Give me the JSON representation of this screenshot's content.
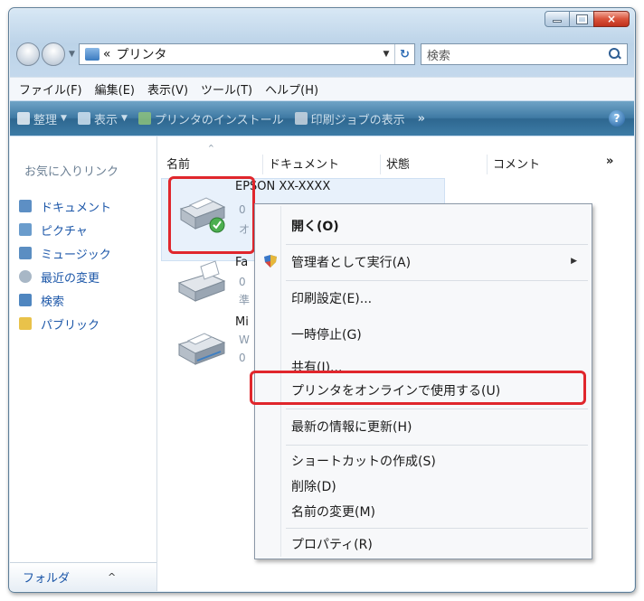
{
  "window": {
    "close_glyph": "×"
  },
  "address": {
    "prefix": "«",
    "path": "プリンタ"
  },
  "search": {
    "placeholder": "検索"
  },
  "menubar": {
    "items": [
      "ファイル(F)",
      "編集(E)",
      "表示(V)",
      "ツール(T)",
      "ヘルプ(H)"
    ]
  },
  "toolbar": {
    "items": [
      {
        "label": "整理",
        "has_dropdown": true
      },
      {
        "label": "表示",
        "has_dropdown": true
      },
      {
        "label": "プリンタのインストール",
        "has_dropdown": false
      },
      {
        "label": "印刷ジョブの表示",
        "has_dropdown": false
      }
    ],
    "more": "»",
    "help": "?"
  },
  "navpane": {
    "title": "お気に入りリンク",
    "items": [
      "ドキュメント",
      "ピクチャ",
      "ミュージック",
      "最近の変更",
      "検索",
      "パブリック"
    ],
    "folders_label": "フォルダ",
    "folders_chevron": "^"
  },
  "columns": {
    "headers": [
      "名前",
      "ドキュメント",
      "状態",
      "コメント"
    ],
    "more": "»"
  },
  "printers": [
    {
      "name": "EPSON XX-XXXX",
      "line1": "0",
      "line2": "オ",
      "selected": true
    },
    {
      "name": "Fa",
      "line1": "0",
      "line2": "準",
      "selected": false
    },
    {
      "name": "Mi",
      "line1": "W",
      "line2": "0",
      "selected": false
    }
  ],
  "context_menu": {
    "items": [
      {
        "label": "開く(O)",
        "bold": true
      },
      {
        "label": "管理者として実行(A)",
        "submenu": true
      },
      {
        "label": "印刷設定(E)..."
      },
      {
        "label": "一時停止(G)"
      },
      {
        "label": "共有(I)..."
      },
      {
        "label": "プリンタをオンラインで使用する(U)",
        "highlighted": true
      },
      {
        "label": "最新の情報に更新(H)"
      },
      {
        "label": "ショートカットの作成(S)"
      },
      {
        "label": "削除(D)"
      },
      {
        "label": "名前の変更(M)"
      },
      {
        "label": "プロパティ(R)"
      }
    ]
  },
  "colors": {
    "highlight_box": "#e0262c",
    "link_blue": "#1b56a8",
    "toolbar_blue": "#3f7aa4"
  }
}
